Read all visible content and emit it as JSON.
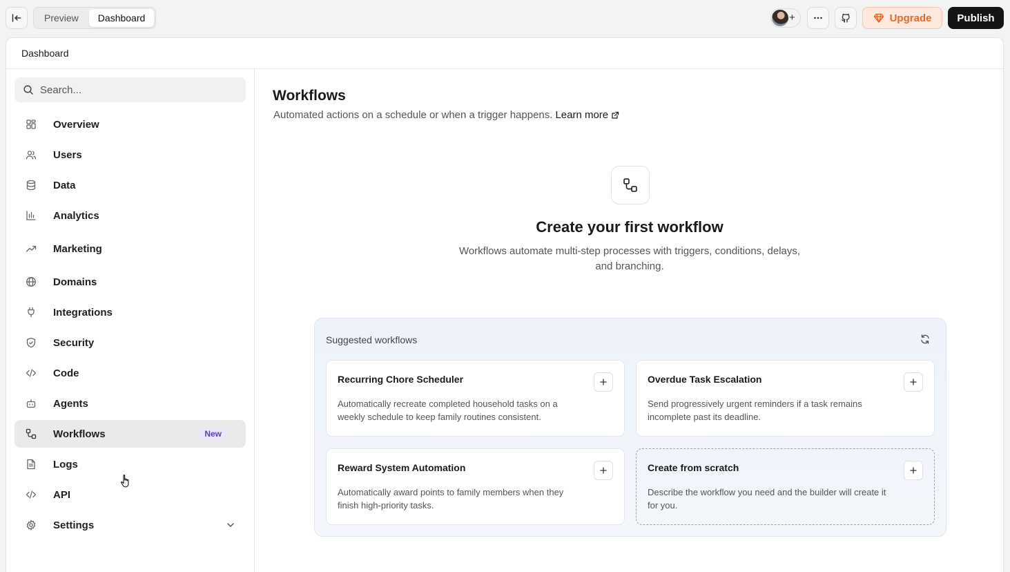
{
  "topbar": {
    "tabs": [
      {
        "label": "Preview",
        "active": false
      },
      {
        "label": "Dashboard",
        "active": true
      }
    ],
    "upgrade_label": "Upgrade",
    "publish_label": "Publish",
    "icons": [
      "collapse-panel-icon",
      "more-icon",
      "github-icon",
      "diamond-icon"
    ]
  },
  "page": {
    "header_title": "Dashboard"
  },
  "sidebar": {
    "search_placeholder": "Search...",
    "items": [
      {
        "label": "Overview",
        "icon": "grid-icon"
      },
      {
        "label": "Users",
        "icon": "users-icon"
      },
      {
        "label": "Data",
        "icon": "database-icon"
      },
      {
        "label": "Analytics",
        "icon": "bar-chart-icon"
      },
      {
        "label": "Marketing",
        "icon": "trending-up-icon"
      },
      {
        "label": "Domains",
        "icon": "globe-icon"
      },
      {
        "label": "Integrations",
        "icon": "plug-icon"
      },
      {
        "label": "Security",
        "icon": "shield-icon"
      },
      {
        "label": "Code",
        "icon": "code-icon"
      },
      {
        "label": "Agents",
        "icon": "bot-icon"
      },
      {
        "label": "Workflows",
        "icon": "workflow-icon",
        "badge": "New",
        "active": true
      },
      {
        "label": "Logs",
        "icon": "file-text-icon"
      },
      {
        "label": "API",
        "icon": "code-icon"
      },
      {
        "label": "Settings",
        "icon": "gear-icon",
        "expandable": true
      }
    ]
  },
  "main": {
    "title": "Workflows",
    "subtitle": "Automated actions on a schedule or when a trigger happens.",
    "learn_more": "Learn more",
    "empty_title": "Create your first workflow",
    "empty_desc": "Workflows automate multi-step processes with triggers, conditions, delays, and branching.",
    "suggested": {
      "title": "Suggested workflows",
      "cards": [
        {
          "title": "Recurring Chore Scheduler",
          "desc": "Automatically recreate completed household tasks on a weekly schedule to keep family routines consistent."
        },
        {
          "title": "Overdue Task Escalation",
          "desc": "Send progressively urgent reminders if a task remains incomplete past its deadline."
        },
        {
          "title": "Reward System Automation",
          "desc": "Automatically award points to family members when they finish high-priority tasks."
        },
        {
          "title": "Create from scratch",
          "desc": "Describe the workflow you need and the builder will create it for you."
        }
      ]
    }
  },
  "colors": {
    "accent_orange": "#e36a2c",
    "badge_purple": "#5a3fc0",
    "publish_bg": "#141414"
  }
}
